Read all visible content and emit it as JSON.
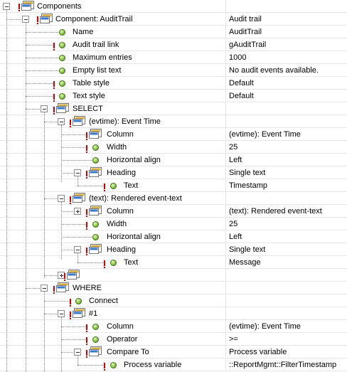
{
  "tree": {
    "root_label": "Components",
    "rows": [
      {
        "label": "Component: AuditTrail",
        "value": "Audit trail"
      },
      {
        "label": "Name",
        "value": "AuditTrail"
      },
      {
        "label": "Audit trail link",
        "value": "gAuditTrail"
      },
      {
        "label": "Maximum entries",
        "value": "1000"
      },
      {
        "label": "Empty list text",
        "value": "No audit events available."
      },
      {
        "label": "Table style",
        "value": "Default"
      },
      {
        "label": "Text style",
        "value": "Default"
      },
      {
        "label": "SELECT",
        "value": ""
      },
      {
        "label": "(evtime): Event Time",
        "value": ""
      },
      {
        "label": "Column",
        "value": "(evtime): Event Time"
      },
      {
        "label": "Width",
        "value": "25"
      },
      {
        "label": "Horizontal align",
        "value": "Left"
      },
      {
        "label": "Heading",
        "value": "Single text"
      },
      {
        "label": "Text",
        "value": "Timestamp"
      },
      {
        "label": "(text): Rendered event-text",
        "value": ""
      },
      {
        "label": "Column",
        "value": "(text): Rendered event-text"
      },
      {
        "label": "Width",
        "value": "25"
      },
      {
        "label": "Horizontal align",
        "value": "Left"
      },
      {
        "label": "Heading",
        "value": "Single text"
      },
      {
        "label": "Text",
        "value": "Message"
      },
      {
        "label": "",
        "value": ""
      },
      {
        "label": "WHERE",
        "value": ""
      },
      {
        "label": "Connect",
        "value": ""
      },
      {
        "label": "#1",
        "value": ""
      },
      {
        "label": "Column",
        "value": "(evtime): Event Time"
      },
      {
        "label": "Operator",
        "value": ">="
      },
      {
        "label": "Compare To",
        "value": "Process variable"
      },
      {
        "label": "Process variable",
        "value": "::ReportMgmt::FilterTimestamp"
      }
    ]
  }
}
